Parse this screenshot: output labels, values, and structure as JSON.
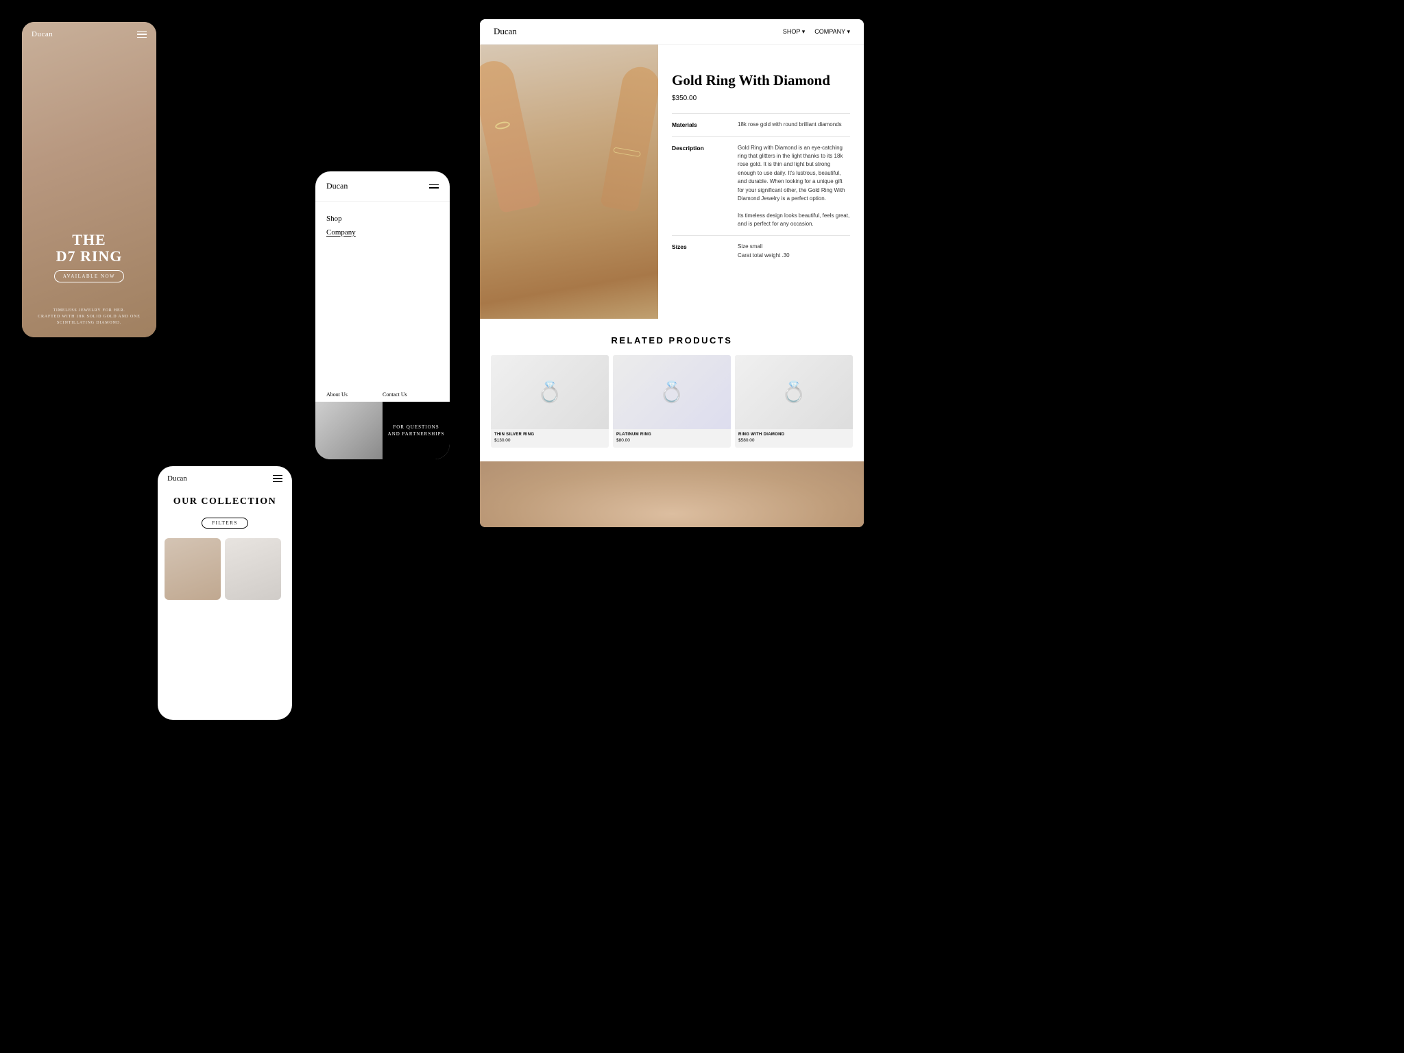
{
  "brand": {
    "name": "Ducan"
  },
  "mobile1": {
    "logo": "Ducan",
    "title": "THE\nD7 RING",
    "cta": "AVAILABLE NOW",
    "footer": "TIMELESS JEWELRY FOR HER.\nCRAFTED WITH 18K SOLID GOLD AND ONE\nSCINTILLATING DIAMOND."
  },
  "mobile2": {
    "logo": "Ducan",
    "nav_items": [
      "Shop",
      "Company"
    ],
    "footer_labels": [
      "About Us",
      "Contact Us"
    ],
    "contact_text": "FOR QUESTIONS\nAND PARTNERSHIPS"
  },
  "mobile3": {
    "logo": "Ducan",
    "title": "OUR COLLECTION",
    "filters_btn": "FILTERS"
  },
  "desktop": {
    "logo": "Ducan",
    "nav_links": [
      "SHOP ▾",
      "COMPANY ▾"
    ],
    "product": {
      "title": "Gold Ring With Diamond",
      "price": "$350.00",
      "details": [
        {
          "label": "Materials",
          "value": "18k rose gold with round brilliant diamonds"
        },
        {
          "label": "Description",
          "value": "Gold Ring with Diamond is an eye-catching ring that glitters in the light thanks to its 18k rose gold. It is thin and light but strong enough to use daily. It's lustrous, beautiful, and durable. When looking for a unique gift for your significant other, the Gold Ring With Diamond Jewelry is a perfect option.\n\nIts timeless design looks beautiful, feels great, and is perfect for any occasion."
        },
        {
          "label": "Sizes",
          "value": "Size small\nCarat total weight .30"
        }
      ]
    },
    "related": {
      "heading": "RELATED PRODUCTS",
      "products": [
        {
          "name": "THIN SILVER RING",
          "price": "$130.00"
        },
        {
          "name": "PLATINUM RING",
          "price": "$80.00"
        },
        {
          "name": "RING WITH DIAMOND",
          "price": "$580.00"
        }
      ]
    }
  }
}
